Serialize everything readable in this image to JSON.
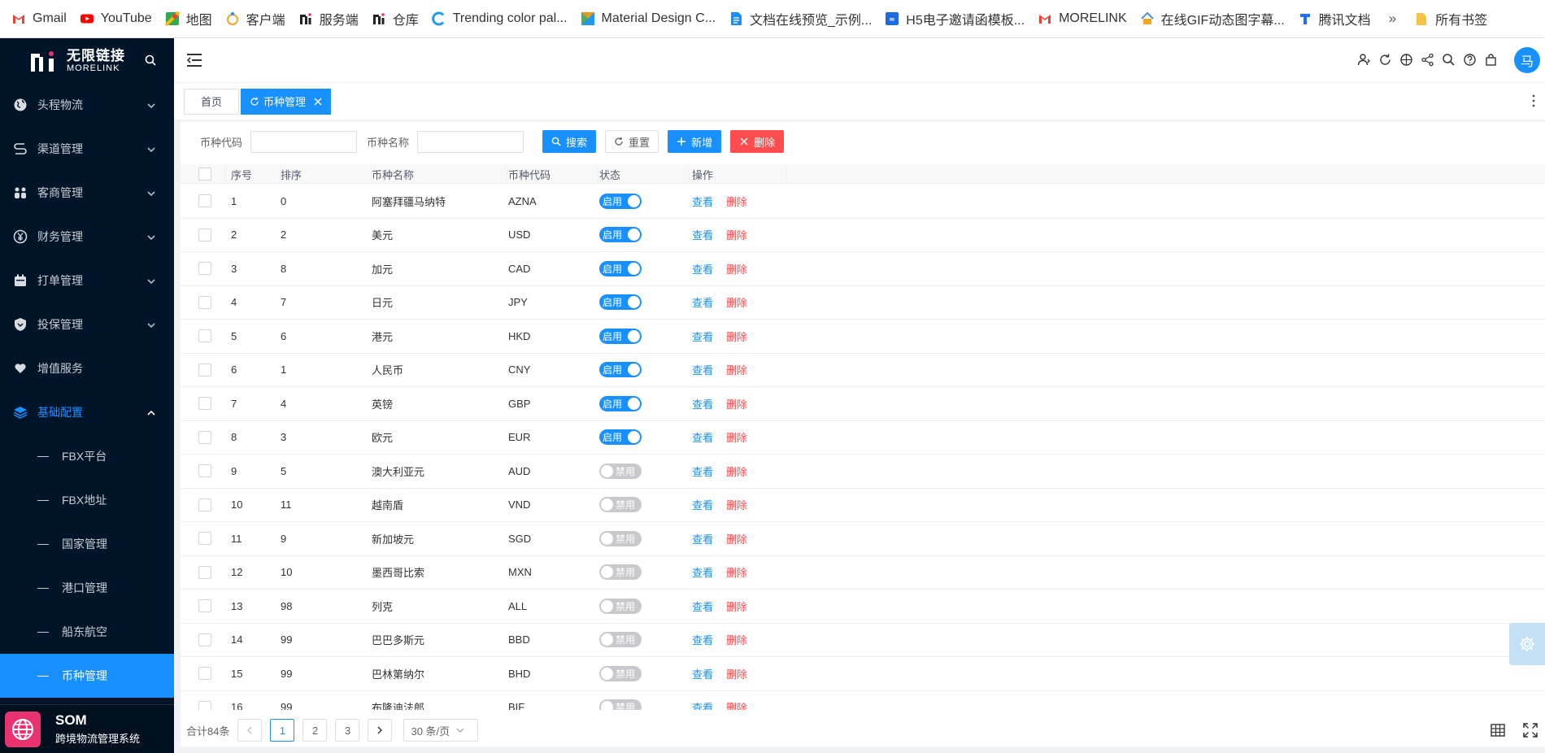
{
  "bookmarks": [
    {
      "label": "Gmail",
      "icon": "gmail-icon",
      "color": "#ea4335"
    },
    {
      "label": "YouTube",
      "icon": "youtube-icon",
      "color": "#ff0000"
    },
    {
      "label": "地图",
      "icon": "maps-icon",
      "color": "#1a73e8"
    },
    {
      "label": "客户端",
      "icon": "customer-client-icon",
      "color": "#f5a623"
    },
    {
      "label": "服务端",
      "icon": "morelink-icon",
      "color": "#222222"
    },
    {
      "label": "仓库",
      "icon": "morelink-icon",
      "color": "#222222"
    },
    {
      "label": "Trending color pal...",
      "icon": "colorpalette-icon",
      "color": "#1e9bf0"
    },
    {
      "label": "Material Design C...",
      "icon": "material-icon",
      "color": "#e99a1d"
    },
    {
      "label": "文档在线预览_示例...",
      "icon": "doc-icon",
      "color": "#1890ff"
    },
    {
      "label": "H5电子邀请函模板...",
      "icon": "h5-icon",
      "color": "#1d6ae5"
    },
    {
      "label": "MORELINK",
      "icon": "gmail-icon",
      "color": "#ea4335"
    },
    {
      "label": "在线GIF动态图字幕...",
      "icon": "gif-icon",
      "color": "#4a90d9"
    },
    {
      "label": "腾讯文档",
      "icon": "tencent-docs-icon",
      "color": "#1e6fff"
    }
  ],
  "bookmarks_more": "»",
  "bookmarks_folder": "所有书签",
  "brand": {
    "title": "无限链接",
    "subtitle": "MORELINK"
  },
  "menu": [
    {
      "label": "头程物流",
      "icon": "globe-icon"
    },
    {
      "label": "渠道管理",
      "icon": "route-icon"
    },
    {
      "label": "客商管理",
      "icon": "users-icon"
    },
    {
      "label": "财务管理",
      "icon": "yen-icon"
    },
    {
      "label": "打单管理",
      "icon": "print-icon"
    },
    {
      "label": "投保管理",
      "icon": "shield-icon"
    },
    {
      "label": "增值服务",
      "icon": "heart-hand-icon"
    },
    {
      "label": "基础配置",
      "icon": "layers-icon"
    }
  ],
  "submenu": [
    "FBX平台",
    "FBX地址",
    "国家管理",
    "港口管理",
    "船东航空",
    "币种管理"
  ],
  "footer": {
    "title": "SOM",
    "subtitle": "跨境物流管理系统"
  },
  "avatar_text": "马",
  "tabs": [
    {
      "label": "首页"
    },
    {
      "label": "币种管理"
    }
  ],
  "filter": {
    "code_label": "币种代码",
    "code_value": "",
    "name_label": "币种名称",
    "name_value": "",
    "search_btn": "搜索",
    "reset_btn": "重置",
    "add_btn": "新增",
    "delete_btn": "删除"
  },
  "table": {
    "headers": [
      "序号",
      "排序",
      "币种名称",
      "币种代码",
      "状态",
      "操作"
    ],
    "view_label": "查看",
    "delete_label": "删除",
    "on_label": "启用",
    "off_label": "禁用",
    "rows": [
      {
        "no": "1",
        "sort": "0",
        "name": "阿塞拜疆马纳特",
        "code": "AZNA",
        "enabled": true
      },
      {
        "no": "2",
        "sort": "2",
        "name": "美元",
        "code": "USD",
        "enabled": true
      },
      {
        "no": "3",
        "sort": "8",
        "name": "加元",
        "code": "CAD",
        "enabled": true
      },
      {
        "no": "4",
        "sort": "7",
        "name": "日元",
        "code": "JPY",
        "enabled": true
      },
      {
        "no": "5",
        "sort": "6",
        "name": "港元",
        "code": "HKD",
        "enabled": true
      },
      {
        "no": "6",
        "sort": "1",
        "name": "人民币",
        "code": "CNY",
        "enabled": true
      },
      {
        "no": "7",
        "sort": "4",
        "name": "英镑",
        "code": "GBP",
        "enabled": true
      },
      {
        "no": "8",
        "sort": "3",
        "name": "欧元",
        "code": "EUR",
        "enabled": true
      },
      {
        "no": "9",
        "sort": "5",
        "name": "澳大利亚元",
        "code": "AUD",
        "enabled": false
      },
      {
        "no": "10",
        "sort": "11",
        "name": "越南盾",
        "code": "VND",
        "enabled": false
      },
      {
        "no": "11",
        "sort": "9",
        "name": "新加坡元",
        "code": "SGD",
        "enabled": false
      },
      {
        "no": "12",
        "sort": "10",
        "name": "墨西哥比索",
        "code": "MXN",
        "enabled": false
      },
      {
        "no": "13",
        "sort": "98",
        "name": "列克",
        "code": "ALL",
        "enabled": false
      },
      {
        "no": "14",
        "sort": "99",
        "name": "巴巴多斯元",
        "code": "BBD",
        "enabled": false
      },
      {
        "no": "15",
        "sort": "99",
        "name": "巴林第纳尔",
        "code": "BHD",
        "enabled": false
      },
      {
        "no": "16",
        "sort": "99",
        "name": "布隆迪法郎",
        "code": "BIF",
        "enabled": false
      }
    ]
  },
  "pager": {
    "total": "合计84条",
    "pages": [
      "1",
      "2",
      "3"
    ],
    "current": "1",
    "size": "30 条/页"
  },
  "colors": {
    "primary": "#1890ff",
    "danger": "#ff4d4f",
    "sidebar": "#001529"
  }
}
